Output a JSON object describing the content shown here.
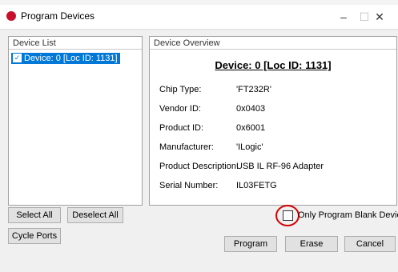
{
  "window": {
    "title": "Program Devices",
    "minimize": "–",
    "maximize": "☐",
    "close": "✕"
  },
  "device_list": {
    "header": "Device List",
    "items": [
      {
        "label": "Device: 0 [Loc ID: 1131]",
        "checked": true
      }
    ]
  },
  "overview": {
    "header": "Device Overview",
    "title": "Device: 0 [Loc ID: 1131]",
    "fields": [
      {
        "label": "Chip Type:",
        "value": "'FT232R'"
      },
      {
        "label": "Vendor ID:",
        "value": "0x0403"
      },
      {
        "label": "Product ID:",
        "value": "0x6001"
      },
      {
        "label": "Manufacturer:",
        "value": "'ILogic'"
      },
      {
        "label": "Product Description:",
        "value": "USB IL RF-96 Adapter"
      },
      {
        "label": "Serial Number:",
        "value": "IL03FETG"
      }
    ]
  },
  "buttons": {
    "select_all": "Select All",
    "deselect_all": "Deselect All",
    "cycle_ports": "Cycle Ports",
    "program": "Program",
    "erase": "Erase",
    "cancel": "Cancel"
  },
  "options": {
    "only_blank_label": "Only Program Blank Devices",
    "only_blank_checked": false
  },
  "colors": {
    "selection": "#0078d7",
    "annotation_circle": "#d40000",
    "app_icon": "#c8102e"
  }
}
